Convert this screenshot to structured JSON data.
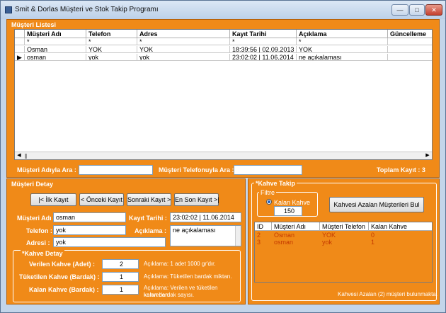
{
  "window": {
    "title": "Smit & Dorlas Müşteri ve Stok Takip Programı",
    "minimize": "—",
    "maximize": "□",
    "close": "✕"
  },
  "musteri_listesi": {
    "title": "Müşteri Listesi",
    "columns": [
      "Müşteri Adı",
      "Telefon",
      "Adres",
      "Kayıt Tarihi",
      "Açıklama",
      "Güncelleme"
    ],
    "filter_marks": [
      "*",
      "*",
      "*",
      "*",
      "*",
      ""
    ],
    "rows": [
      {
        "marker": "",
        "ad": "Osman",
        "telefon": "YOK",
        "adres": "YOK",
        "kayit": "18:39:56 | 02.09.2013",
        "aciklama": "YOK",
        "guncelleme": ""
      },
      {
        "marker": "▶",
        "ad": "osman",
        "telefon": "yok",
        "adres": "yok",
        "kayit": "23:02:02 | 11.06.2014",
        "aciklama": "ne açıkalaması",
        "guncelleme": ""
      }
    ],
    "search_name_label": "Müşteri Adıyla Ara :",
    "search_name_value": "",
    "search_phone_label": "Müşteri Telefonuyla Ara :",
    "search_phone_value": "",
    "total_label": "Toplam Kayıt : 3"
  },
  "musteri_detay": {
    "title": "Müşteri Detay",
    "buttons": {
      "first": "|< İlk Kayıt",
      "prev": "< Önceki Kayıt",
      "next": "Sonraki Kayıt >",
      "last": "En Son Kayıt >|"
    },
    "ad_label": "Müşteri Adı :",
    "ad_value": "osman",
    "telefon_label": "Telefon :",
    "telefon_value": "yok",
    "adres_label": "Adresi :",
    "adres_value": "yok",
    "kayit_label": "Kayıt Tarihi :",
    "kayit_value": "23:02:02 | 11.06.2014",
    "aciklama_label": "Açıklama :",
    "aciklama_value": "ne açıkalaması"
  },
  "kahve_detay": {
    "title": "*Kahve Detay",
    "verilen_label": "Verilen Kahve (Adet) :",
    "verilen_value": "2",
    "verilen_note": "Açıklama: 1 adet 1000 gr'dır.",
    "tuketilen_label": "Tüketilen Kahve (Bardak) :",
    "tuketilen_value": "1",
    "tuketilen_note": "Açıklama: Tüketilen bardak miktarı.",
    "kalan_label": "Kalan Kahve (Bardak) :",
    "kalan_value": "1",
    "kalan_note_1": "Açıklama: Verilen ve tüketilen kahveden",
    "kalan_note_2": "kalan bardak sayısı."
  },
  "kahve_takip": {
    "title": "*Kahve Takip",
    "filtre_label": "Filtre",
    "radio_label": "Kalan Kahve",
    "filtre_value": "150",
    "find_button": "Kahvesi Azalan Müşterileri Bul",
    "columns": [
      "ID",
      "Müşteri Adı",
      "Müşteri Telefon",
      "Kalan Kahve"
    ],
    "rows": [
      {
        "id": "2",
        "ad": "Osman",
        "telefon": "YOK",
        "kalan": "0"
      },
      {
        "id": "3",
        "ad": "osman",
        "telefon": "yok",
        "kalan": "1"
      }
    ],
    "status": "Kahvesi Azalan (2) müşteri bulunmakta."
  },
  "colors": {
    "panel": "#f08a18",
    "grid_row_text": "#c43a00"
  }
}
